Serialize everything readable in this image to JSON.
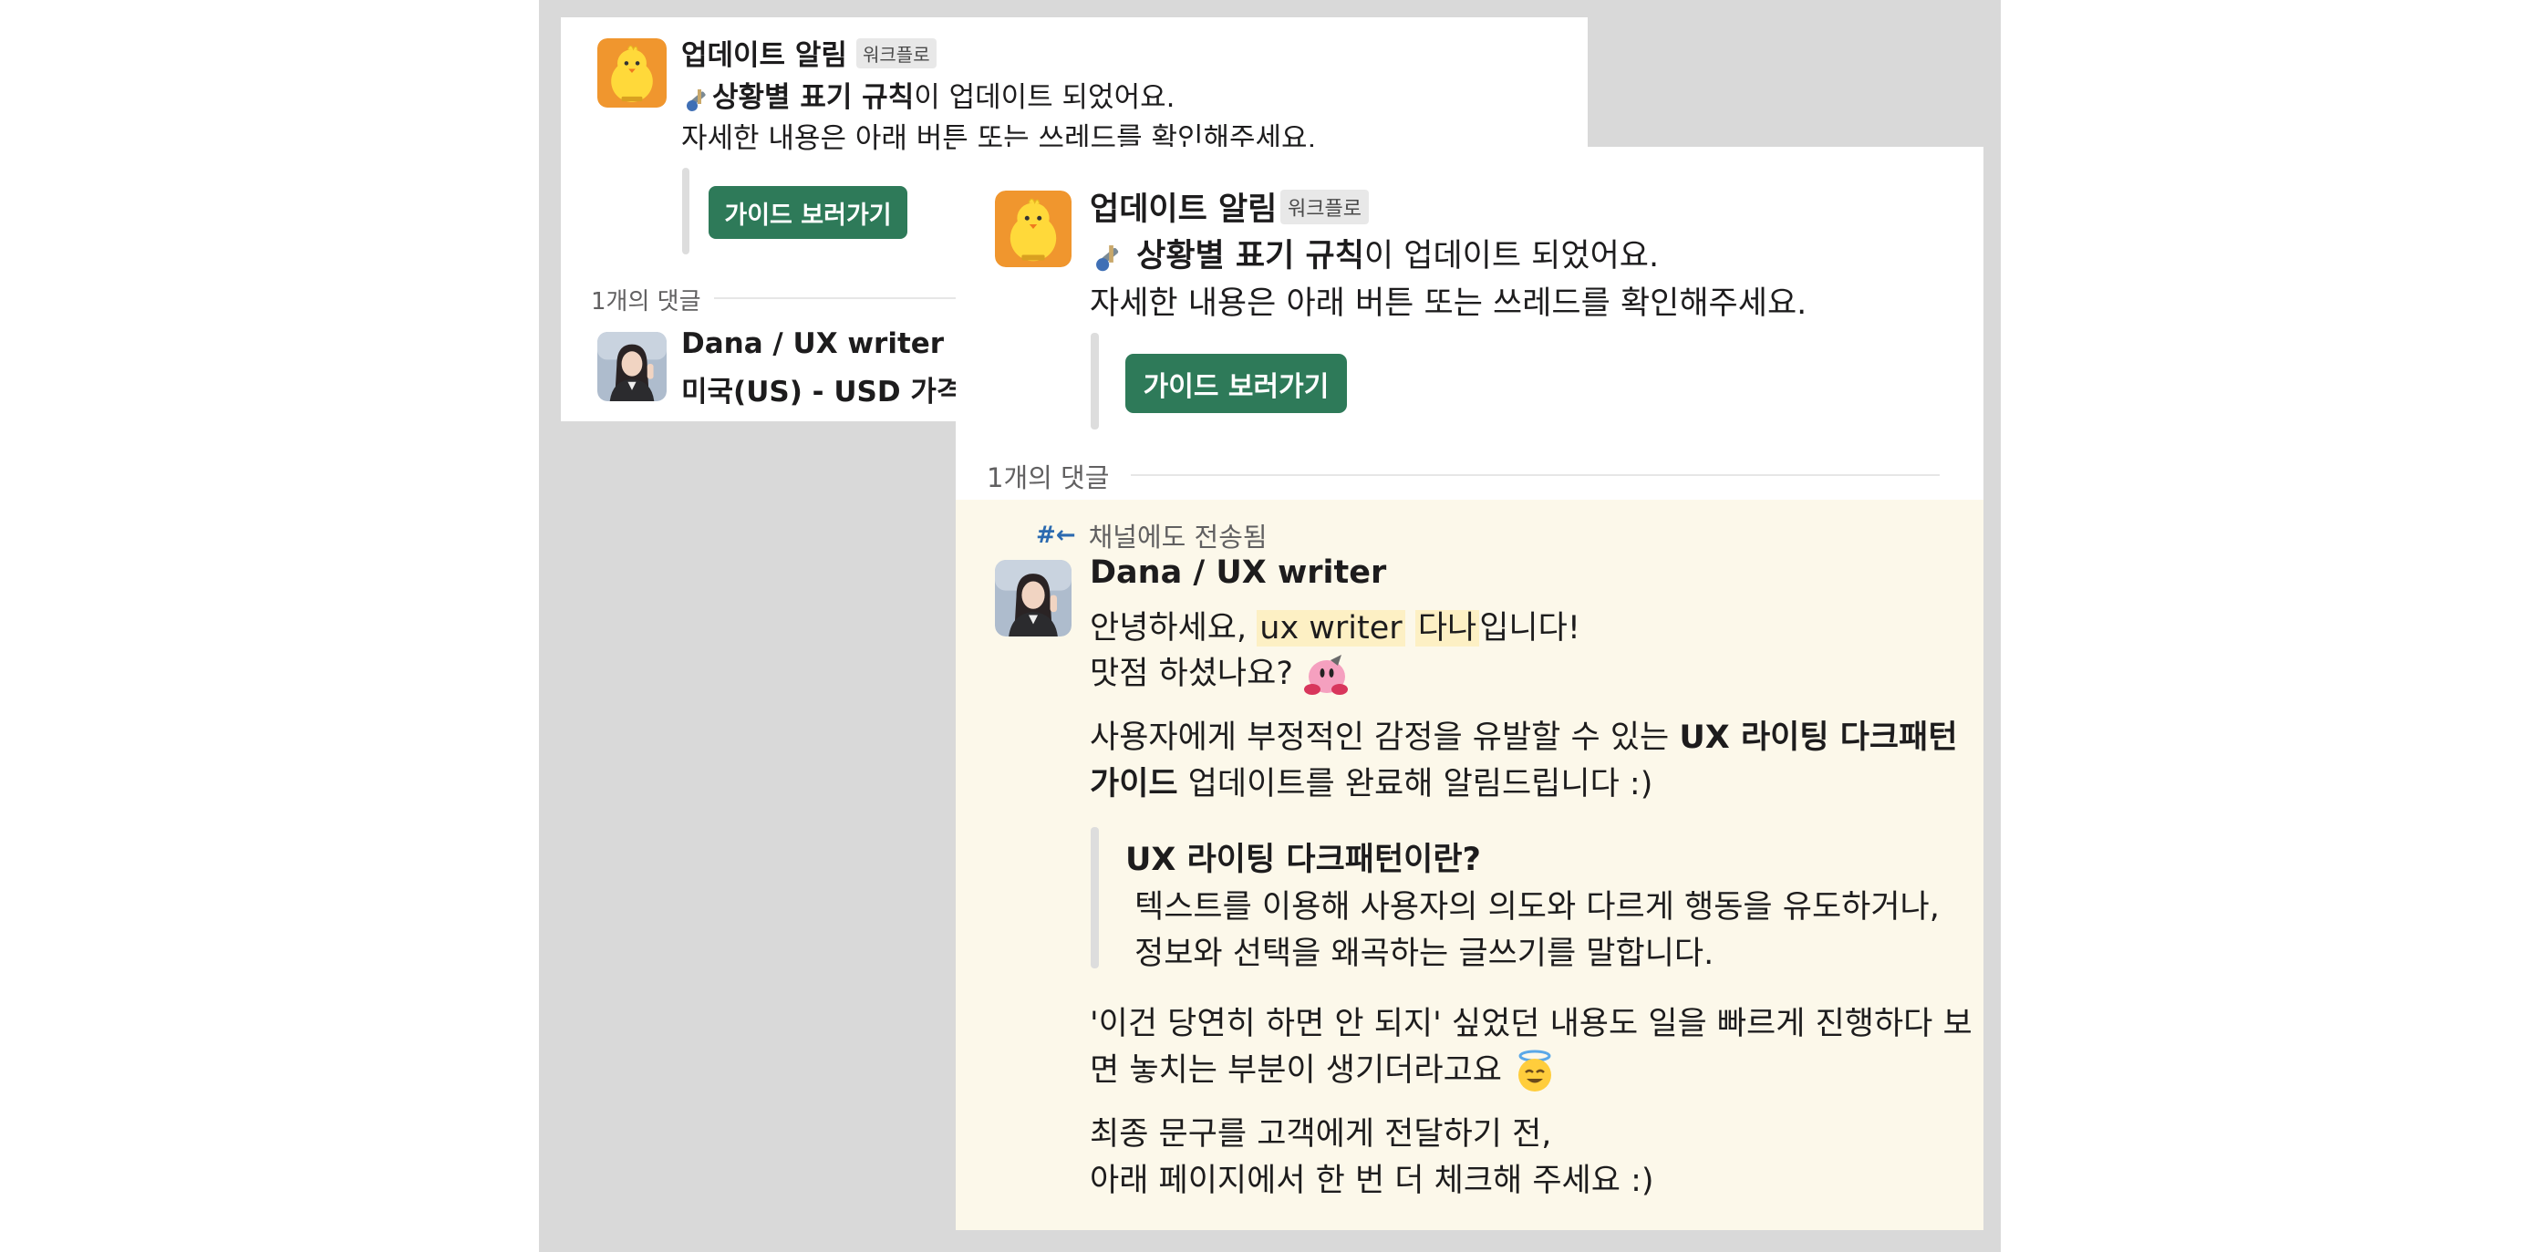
{
  "back_card": {
    "sender": "업데이트 알림",
    "tag": "워크플로",
    "line1_bold": "상황별 표기 규칙",
    "line1_rest": "이 업데이트 되었어요.",
    "line2": "자세한 내용은 아래 버튼 또는 쓰레드를 확인해주세요.",
    "button": "가이드 보러가기",
    "replies": "1개의 댓글",
    "reply_name": "Dana / UX writer",
    "reply_text": "미국(US) - USD 가격 표"
  },
  "front_card": {
    "sender": "업데이트 알림",
    "tag": "워크플로",
    "line1_bold": "상황별 표기 규칙",
    "line1_rest": "이 업데이트 되었어요.",
    "line2": "자세한 내용은 아래 버튼 또는 쓰레드를 확인해주세요.",
    "button": "가이드 보러가기",
    "replies": "1개의 댓글"
  },
  "reply": {
    "sent_icon": "#←",
    "sent_label": "채널에도 전송됨",
    "name": "Dana / UX writer",
    "greet_a": "안녕하세요, ",
    "greet_hl1": "ux writer",
    "greet_hl2": "다나",
    "greet_b": "입니다!",
    "line2": "맛점 하셨나요?",
    "p1_a": "사용자에게 부정적인 감정을 유발할 수 있는 ",
    "p1_bold": "UX 라이팅 다크패턴",
    "p1_bold2": "가이드",
    "p1_b": " 업데이트를 완료해 알림드립니다 :)",
    "quote_title": "UX 라이팅 다크패턴이란?",
    "quote_l1": "텍스트를 이용해 사용자의 의도와 다르게 행동을 유도하거나,",
    "quote_l2": "정보와 선택을 왜곡하는 글쓰기를 말합니다.",
    "p2_l1": "'이건 당연히 하면 안 되지' 싶었던 내용도 일을 빠르게 진행하다 보",
    "p2_l2": "면 놓치는 부분이 생기더라고요",
    "p3_l1": "최종 문구를 고객에게 전달하기 전,",
    "p3_l2": "아래 페이지에서 한 번 더 체크해 주세요 :)"
  },
  "icons": {
    "bot_avatar": "yellow-chick-avatar",
    "user_avatar": "woman-photo-avatar",
    "rule_emoji": "ruler-tools-emoji",
    "kirby_emoji": "pink-kirby-emoji",
    "angel_emoji": "smiling-halo-emoji"
  },
  "colors": {
    "button": "#2e7a59",
    "reply_bg": "#fcf8ea",
    "highlight": "#fdf0c4",
    "muted_text": "#616061",
    "channel_icon": "#2b6ab0"
  }
}
